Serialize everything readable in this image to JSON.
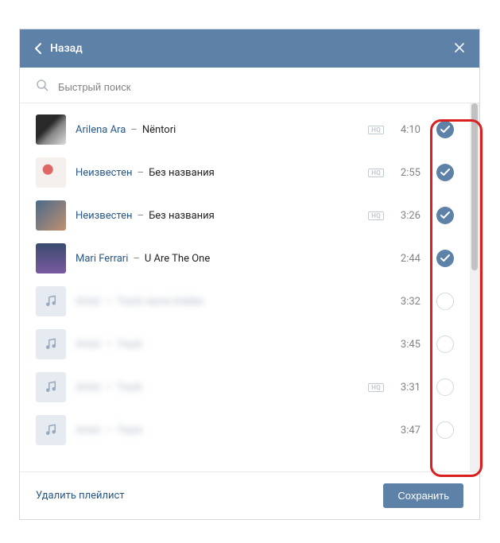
{
  "header": {
    "back_label": "Назад"
  },
  "search": {
    "placeholder": "Быстрый поиск"
  },
  "hq_label": "HQ",
  "tracks": [
    {
      "artist": "Arilena Ara",
      "title": "Nëntori",
      "duration": "4:10",
      "hq": true,
      "selected": true,
      "art": "art1",
      "blur": false
    },
    {
      "artist": "Неизвестен",
      "title": "Без названия",
      "duration": "2:55",
      "hq": true,
      "selected": true,
      "art": "art2",
      "blur": false
    },
    {
      "artist": "Неизвестен",
      "title": "Без названия",
      "duration": "3:26",
      "hq": true,
      "selected": true,
      "art": "art3",
      "blur": false
    },
    {
      "artist": "Mari Ferrari",
      "title": "U Are The One",
      "duration": "2:44",
      "hq": false,
      "selected": true,
      "art": "art4",
      "blur": false
    },
    {
      "artist": "Artist",
      "title": "Track name hidden",
      "duration": "3:32",
      "hq": false,
      "selected": false,
      "art": "note",
      "blur": true
    },
    {
      "artist": "Artist",
      "title": "Track",
      "duration": "3:45",
      "hq": false,
      "selected": false,
      "art": "note",
      "blur": true
    },
    {
      "artist": "Artist",
      "title": "Track",
      "duration": "3:31",
      "hq": true,
      "selected": false,
      "art": "note",
      "blur": true
    },
    {
      "artist": "Artist",
      "title": "Track",
      "duration": "3:47",
      "hq": false,
      "selected": false,
      "art": "note",
      "blur": true
    }
  ],
  "footer": {
    "delete_label": "Удалить плейлист",
    "save_label": "Сохранить"
  }
}
